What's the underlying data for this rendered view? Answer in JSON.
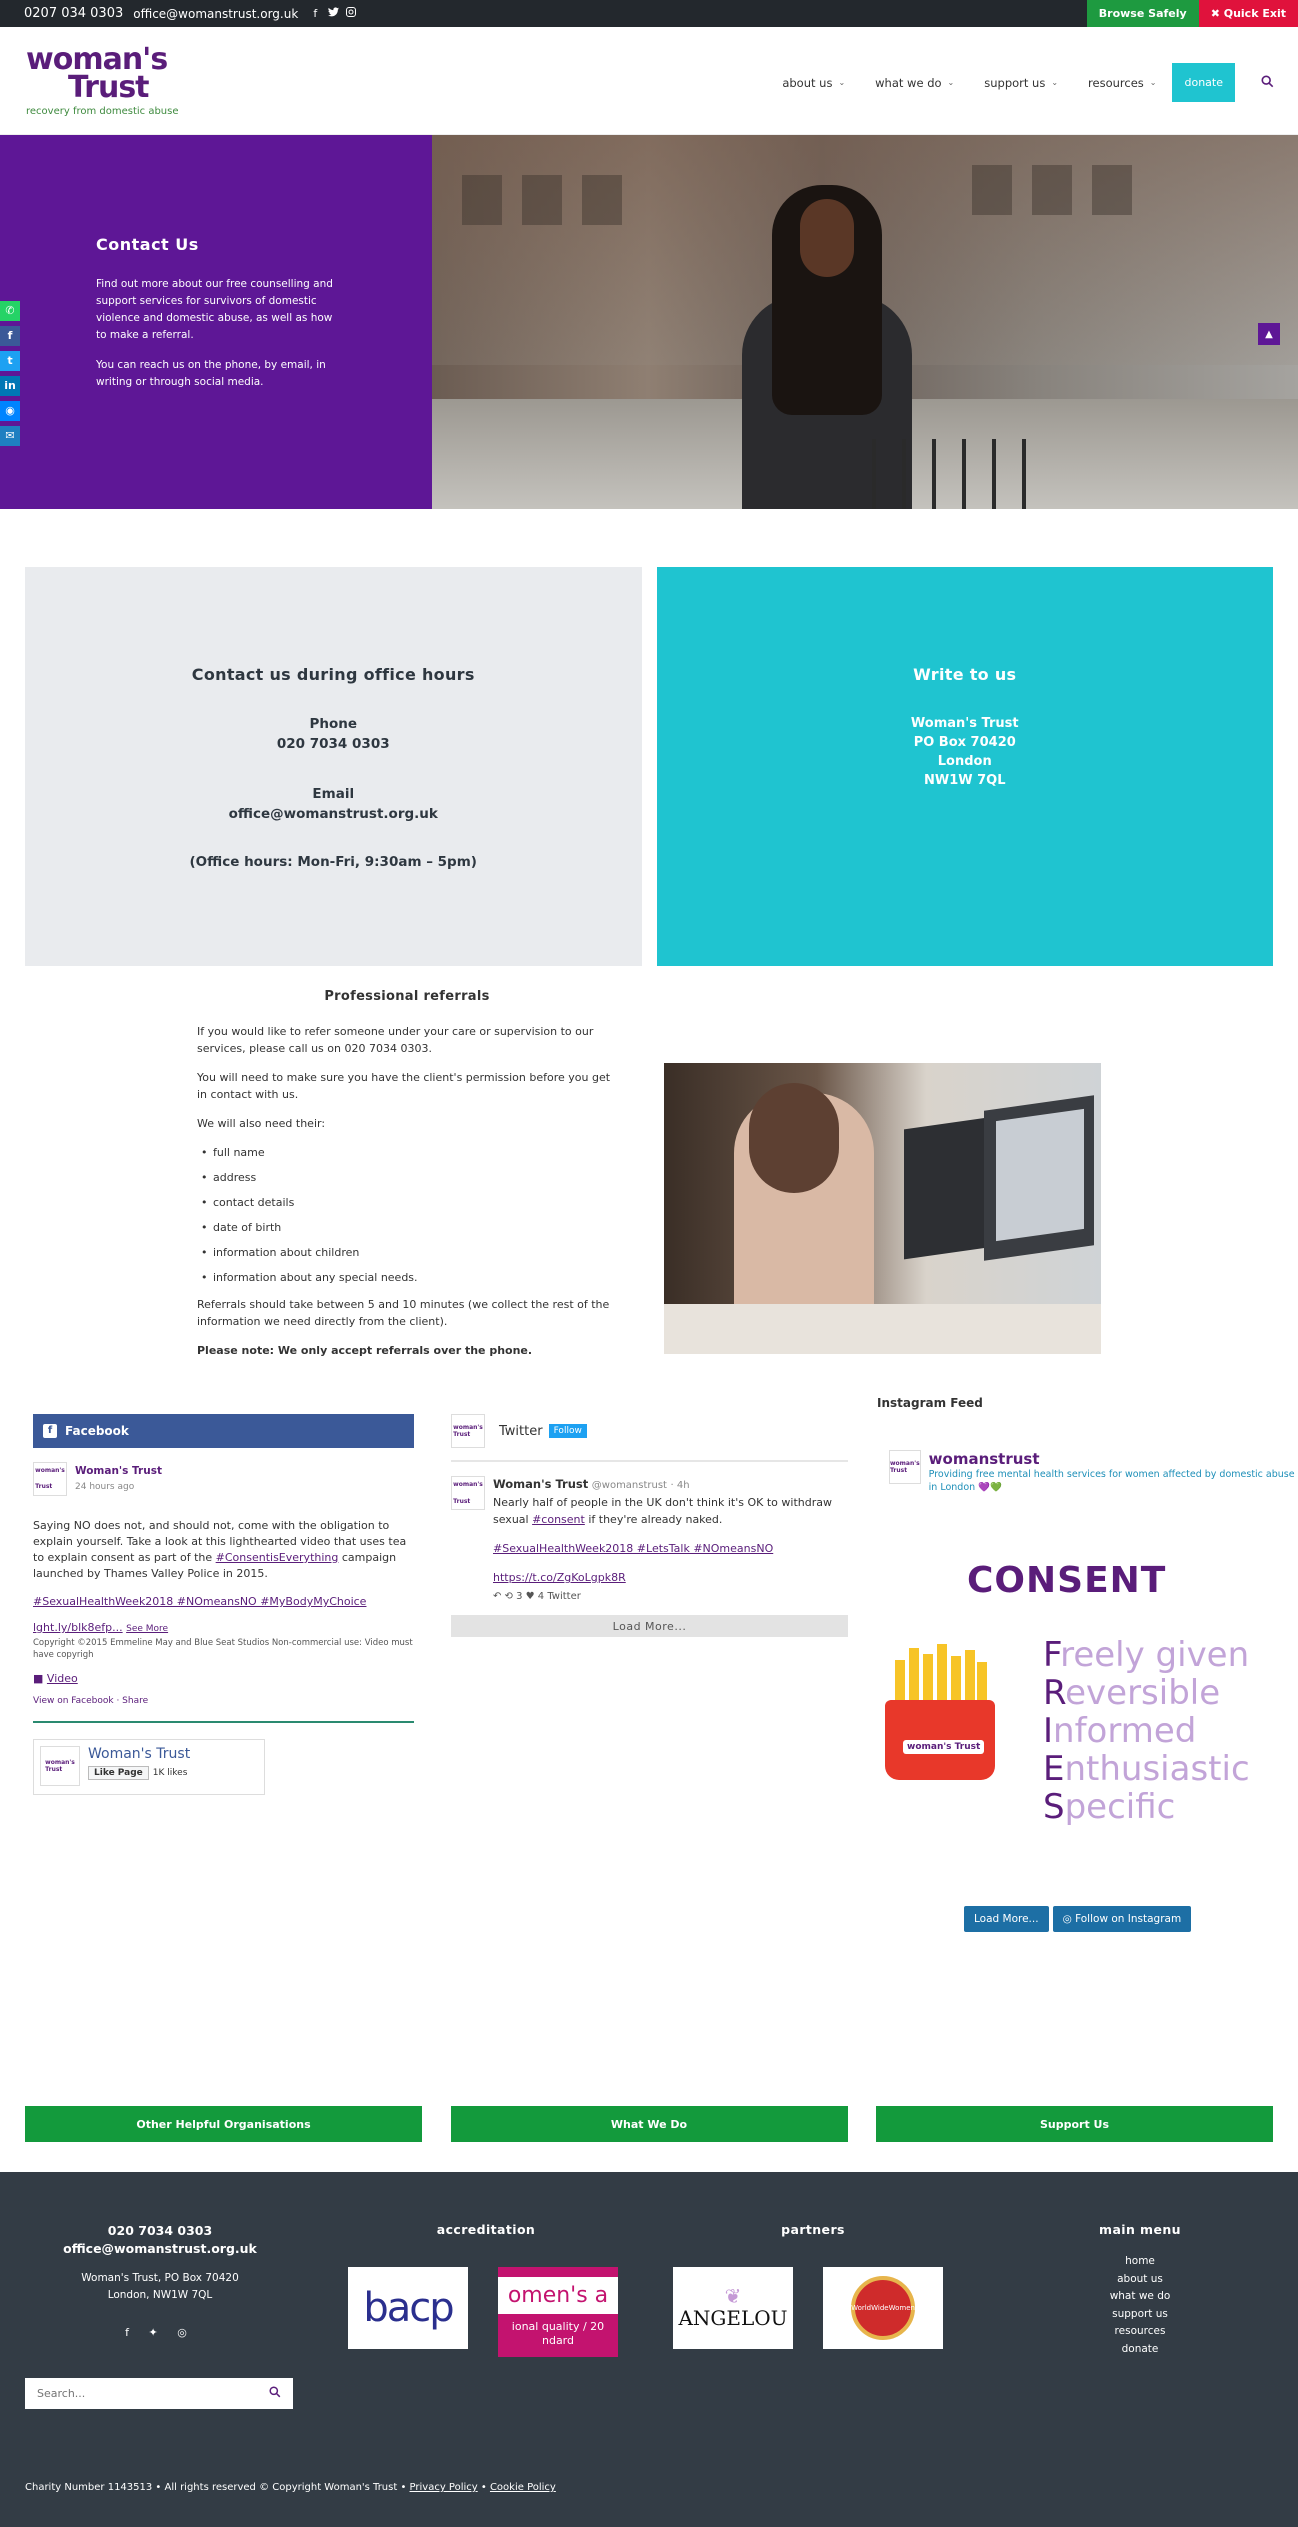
{
  "topbar": {
    "phone": "0207 034 0303",
    "email": "office@womanstrust.org.uk",
    "social_icons": [
      "facebook-icon",
      "twitter-icon",
      "instagram-icon"
    ],
    "browse_safely": "Browse Safely",
    "quick_exit": "✖ Quick Exit"
  },
  "header": {
    "logo_line1": "woman's",
    "logo_line2": "Trust",
    "tagline": "recovery from domestic abuse",
    "nav": [
      {
        "label": "about us"
      },
      {
        "label": "what we do"
      },
      {
        "label": "support us"
      },
      {
        "label": "resources"
      }
    ],
    "donate": "donate",
    "chevron": "⌄",
    "search_icon": "⌕"
  },
  "hero": {
    "title": "Contact Us",
    "p1": "Find out more about our free counselling and support services for survivors of domestic violence and domestic abuse, as well as how to make a referral.",
    "p2": "You can reach us on the phone, by email, in writing or through social media.",
    "share_icons": [
      "whatsapp-icon",
      "facebook-icon",
      "twitter-icon",
      "linkedin-icon",
      "messenger-icon",
      "email-icon"
    ]
  },
  "office_box": {
    "title": "Contact us during office hours",
    "phone_label": "Phone",
    "phone": "020 7034 0303",
    "email_label": "Email",
    "email": "office@womanstrust.org.uk",
    "hours": "(Office hours: Mon-Fri, 9:30am – 5pm)"
  },
  "write_box": {
    "title": "Write to us",
    "lines": [
      "Woman's Trust",
      "PO Box 70420",
      "London",
      "NW1W 7QL"
    ]
  },
  "referrals": {
    "title": "Professional referrals",
    "p1": "If you would like to refer someone under your care or supervision to our services, please call us on 020 7034 0303.",
    "p2": "You will need to make sure you have the client's permission before you get in contact with us.",
    "p3": "We will also need their:",
    "items": [
      "full name",
      "address",
      "contact details",
      "date of birth",
      "information about children",
      "information about any special needs."
    ],
    "p4": "Referrals should take between 5 and 10 minutes (we collect the rest of the information we need directly from the client).",
    "note": "Please note: We only accept referrals over the phone."
  },
  "facebook": {
    "header": "Facebook",
    "author": "Woman's Trust",
    "time": "24 hours ago",
    "text_a": "Saying NO does not, and should not, come with the obligation to explain yourself. Take a look at this lighthearted video that uses tea to explain consent as part of the ",
    "text_link": "#ConsentisEverything",
    "text_b": " campaign launched by Thames Valley Police in 2015.",
    "tags": "#SexualHealthWeek2018 #NOmeansNO #MyBodyMyChoice",
    "short_link": "lght.ly/blk8efp...",
    "see_more": "See More",
    "copyright": "Copyright ©2015 Emmeline May and Blue Seat Studios Non-commercial use: Video must have copyrigh",
    "video": "Video",
    "view_on": "View on Facebook",
    "share": "Share",
    "page_name": "Woman's Trust",
    "like_page": "Like Page",
    "likes": "1K likes"
  },
  "twitter": {
    "title": "Twitter",
    "follow": "Follow",
    "name": "Woman's Trust",
    "handle": "@womanstrust",
    "time": "4h",
    "text_a": "Nearly half of people in the UK don't think it's OK to withdraw sexual ",
    "text_link": "#consent",
    "text_b": " if they're already naked.",
    "tags": "#SexualHealthWeek2018 #LetsTalk #NOmeansNO",
    "url": "https://t.co/ZgKoLgpk8R",
    "actions": "↶   ⟲ 3   ♥ 4   Twitter",
    "load_more": "Load More..."
  },
  "instagram": {
    "title": "Instagram Feed",
    "name": "womanstrust",
    "bio": "Providing free mental health services for women affected by domestic abuse in London 💜💚",
    "consent": "CONSENT",
    "fries_label": "woman's Trust",
    "words": [
      {
        "first": "F",
        "rest": "reely given"
      },
      {
        "first": "R",
        "rest": "eversible"
      },
      {
        "first": "I",
        "rest": "nformed"
      },
      {
        "first": "E",
        "rest": "nthusiastic"
      },
      {
        "first": "S",
        "rest": "pecific"
      }
    ],
    "load_more": "Load More...",
    "follow": "Follow on Instagram"
  },
  "green_buttons": [
    "Other Helpful Organisations",
    "What We Do",
    "Support Us"
  ],
  "footer": {
    "phone": "020 7034 0303",
    "email": "office@womanstrust.org.uk",
    "address1": "Woman's Trust, PO Box 70420",
    "address2": "London, NW1W 7QL",
    "social": "f  ✦  ◎",
    "accreditation_title": "accreditation",
    "bacp": "bacp",
    "wa_top": "omen's a",
    "wa_bottom": "ional quality / 20 ndard",
    "partners_title": "partners",
    "angelou": "ANGELOU",
    "wwo": "WorldWideWomen",
    "menu_title": "main menu",
    "menu": [
      "home",
      "about us",
      "what we do",
      "support us",
      "resources",
      "donate"
    ],
    "search_placeholder": "Search...",
    "charity": "Charity Number 1143513 • All rights reserved © Copyright Woman's Trust • ",
    "privacy": "Privacy Policy",
    "sep": " • ",
    "cookie": "Cookie Policy"
  },
  "colors": {
    "purple": "#5e1796",
    "teal": "#1fc4d0",
    "green": "#139a3c",
    "red": "#e0123c",
    "footer": "#333c45"
  }
}
